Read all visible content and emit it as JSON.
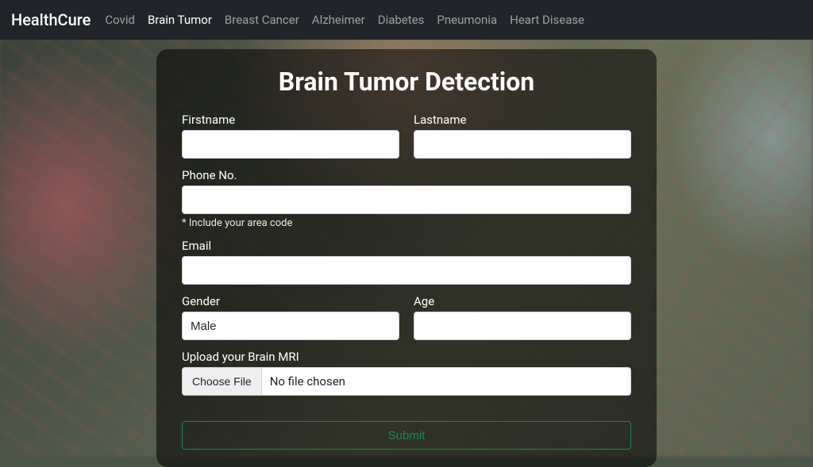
{
  "nav": {
    "brand": "HealthCure",
    "items": [
      {
        "label": "Covid",
        "active": false
      },
      {
        "label": "Brain Tumor",
        "active": true
      },
      {
        "label": "Breast Cancer",
        "active": false
      },
      {
        "label": "Alzheimer",
        "active": false
      },
      {
        "label": "Diabetes",
        "active": false
      },
      {
        "label": "Pneumonia",
        "active": false
      },
      {
        "label": "Heart Disease",
        "active": false
      }
    ]
  },
  "form": {
    "title": "Brain Tumor Detection",
    "firstname_label": "Firstname",
    "lastname_label": "Lastname",
    "phone_label": "Phone No.",
    "phone_help": "* Include your area code",
    "email_label": "Email",
    "gender_label": "Gender",
    "gender_value": "Male",
    "age_label": "Age",
    "upload_label": "Upload your Brain MRI",
    "file_button": "Choose File",
    "file_status": "No file chosen",
    "submit_label": "Submit"
  }
}
